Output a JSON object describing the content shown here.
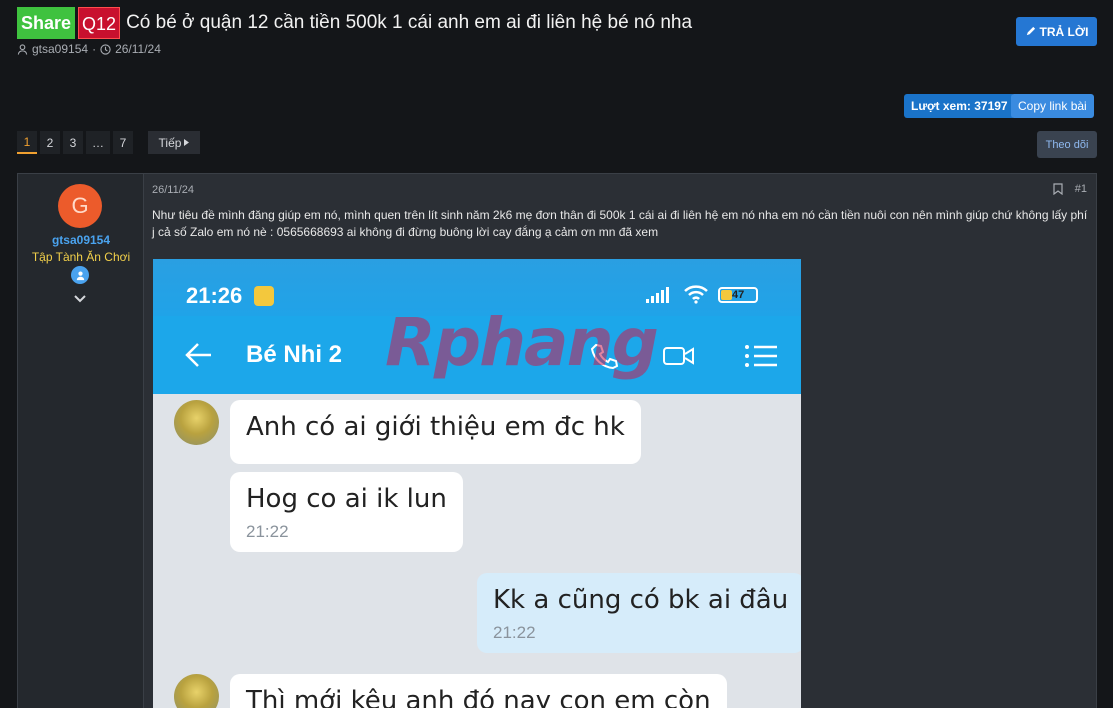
{
  "thread": {
    "prefix_share": "Share",
    "prefix_region": "Q12",
    "title": "Có bé ở quận 12 cần tiền 500k 1 cái anh em ai đi liên hệ bé nó nha",
    "author": "gtsa09154",
    "date": "26/11/24"
  },
  "toolbar": {
    "reply_label": "TRẢ LỜI",
    "views_label": "Lượt xem: 37197",
    "copy_label": "Copy link bài",
    "follow_label": "Theo dõi"
  },
  "pagination": {
    "pages": [
      "1",
      "2",
      "3",
      "…",
      "7"
    ],
    "current": "1",
    "next_label": "Tiếp"
  },
  "post": {
    "date": "26/11/24",
    "number": "#1",
    "text": "Như tiêu đề mình đăng giúp em nó, mình quen trên lít sinh năm 2k6 mẹ đơn thân đi 500k 1 cái ai đi liên hệ em nó nha em nó cần tiền nuôi con nên mình giúp chứ không lấy phí j cả số Zalo em nó nè : 0565668693 ai không đi đừng buông lời cay đắng ạ cảm ơn mn đã xem",
    "user": {
      "avatar_letter": "G",
      "name": "gtsa09154",
      "title": "Tập Tành Ăn Chơi"
    }
  },
  "screenshot": {
    "time": "21:26",
    "battery": "47",
    "contact": "Bé Nhi 2",
    "watermark": "Rphang",
    "messages": [
      {
        "text": "Anh có ai giới thiệu em đc hk",
        "time": ""
      },
      {
        "text": "Hog co ai ik lun",
        "time": "21:22"
      },
      {
        "text": "Kk a cũng có bk ai đâu",
        "time": "21:22"
      },
      {
        "text": "Thì mới kêu anh đó nay con em còn",
        "time": ""
      }
    ]
  },
  "colors": {
    "share": "#3fc23f",
    "region": "#c8102e",
    "accent": "#2577d3",
    "username": "#4aa3ef",
    "usertitle": "#f2d04a"
  }
}
